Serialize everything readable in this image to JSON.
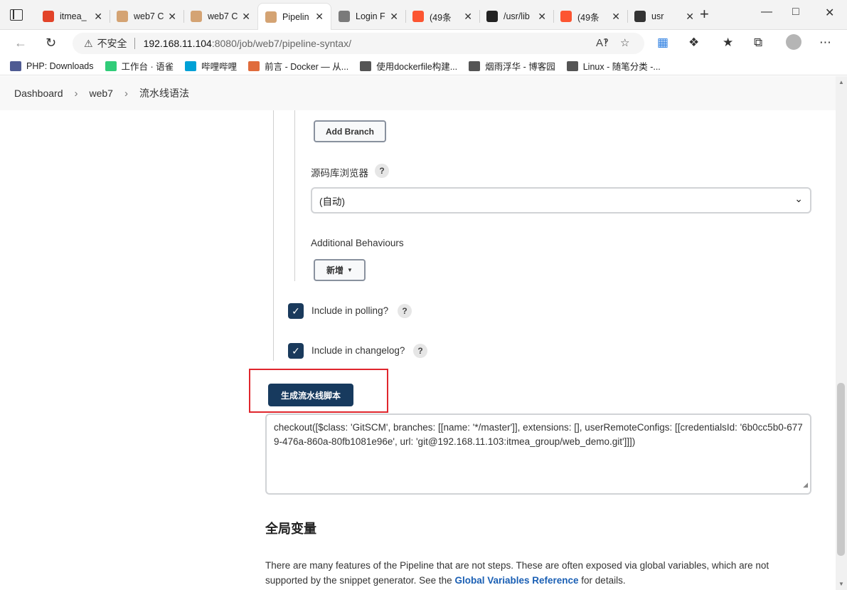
{
  "browser": {
    "tabs": [
      {
        "label": "itmea_",
        "icon": "gitlab-icon",
        "color": "#e24329"
      },
      {
        "label": "web7 C",
        "icon": "jenkins-icon",
        "color": "#d4a373"
      },
      {
        "label": "web7 C",
        "icon": "jenkins-icon",
        "color": "#d4a373"
      },
      {
        "label": "Pipelin",
        "icon": "jenkins-icon",
        "color": "#d4a373"
      },
      {
        "label": "Login F",
        "icon": "image-icon",
        "color": "#7a7a7a"
      },
      {
        "label": "(49条",
        "icon": "csdn-icon",
        "color": "#fc5531"
      },
      {
        "label": "/usr/lib",
        "icon": "github-icon",
        "color": "#222222"
      },
      {
        "label": "(49条",
        "icon": "csdn-icon",
        "color": "#fc5531"
      },
      {
        "label": "usr",
        "icon": "doc-icon",
        "color": "#333333"
      }
    ],
    "tab_close_glyph": "✕",
    "new_tab_glyph": "+",
    "address": {
      "insecure_label": "不安全",
      "host": "192.168.11.104",
      "path": ":8080/job/web7/pipeline-syntax/"
    },
    "bookmarks": [
      {
        "label": "PHP: Downloads",
        "icon": "php-icon",
        "color": "#4f5b93"
      },
      {
        "label": "工作台 · 语雀",
        "icon": "yuque-icon",
        "color": "#31cc79"
      },
      {
        "label": "哔哩哔哩",
        "icon": "bilibili-icon",
        "color": "#00a1d6"
      },
      {
        "label": "前言 - Docker — 从...",
        "icon": "rocket-icon",
        "color": "#e06c3c"
      },
      {
        "label": "使用dockerfile构建...",
        "icon": "cnblogs-icon",
        "color": "#555555"
      },
      {
        "label": "烟雨浮华 - 博客园",
        "icon": "cnblogs-icon",
        "color": "#555555"
      },
      {
        "label": "Linux - 随笔分类 -...",
        "icon": "cnblogs-icon",
        "color": "#555555"
      }
    ]
  },
  "breadcrumb": [
    "Dashboard",
    "web7",
    "流水线语法"
  ],
  "form": {
    "add_branch_label": "Add Branch",
    "repo_browser_label": "源码库浏览器",
    "repo_browser_value": "(自动)",
    "additional_behaviours_label": "Additional Behaviours",
    "add_label": "新增",
    "include_polling_label": "Include in polling?",
    "include_polling_checked": true,
    "include_changelog_label": "Include in changelog?",
    "include_changelog_checked": true,
    "help_glyph": "?",
    "generate_button_label": "生成流水线脚本",
    "generated_script": "checkout([$class: 'GitSCM', branches: [[name: '*/master']], extensions: [], userRemoteConfigs: [[credentialsId: '6b0cc5b0-6779-476a-860a-80fb1081e96e', url: 'git@192.168.11.103:itmea_group/web_demo.git']]])"
  },
  "global_vars": {
    "title": "全局变量",
    "desc_before": "There are many features of the Pipeline that are not steps. These are often exposed via global variables, which are not supported by the snippet generator. See the ",
    "link_label": "Global Variables Reference",
    "desc_after": " for details."
  }
}
